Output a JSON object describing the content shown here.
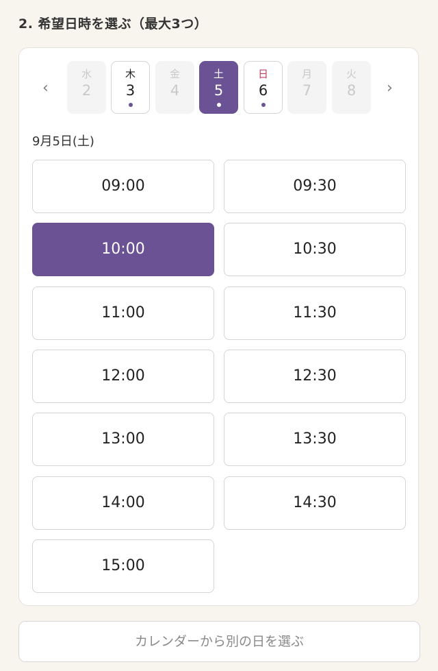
{
  "section": {
    "title": "2. 希望日時を選ぶ（最大3つ）"
  },
  "nav": {
    "prev": "‹",
    "next": "›"
  },
  "days": [
    {
      "weekday": "水",
      "date": "2",
      "state": "disabled"
    },
    {
      "weekday": "木",
      "date": "3",
      "state": "available"
    },
    {
      "weekday": "金",
      "date": "4",
      "state": "disabled"
    },
    {
      "weekday": "土",
      "date": "5",
      "state": "selected"
    },
    {
      "weekday": "日",
      "date": "6",
      "state": "available"
    },
    {
      "weekday": "月",
      "date": "7",
      "state": "disabled"
    },
    {
      "weekday": "火",
      "date": "8",
      "state": "disabled"
    }
  ],
  "selected_date_label": "9月5日(土)",
  "slots": [
    {
      "time": "09:00",
      "selected": false
    },
    {
      "time": "09:30",
      "selected": false
    },
    {
      "time": "10:00",
      "selected": true
    },
    {
      "time": "10:30",
      "selected": false
    },
    {
      "time": "11:00",
      "selected": false
    },
    {
      "time": "11:30",
      "selected": false
    },
    {
      "time": "12:00",
      "selected": false
    },
    {
      "time": "12:30",
      "selected": false
    },
    {
      "time": "13:00",
      "selected": false
    },
    {
      "time": "13:30",
      "selected": false
    },
    {
      "time": "14:00",
      "selected": false
    },
    {
      "time": "14:30",
      "selected": false
    },
    {
      "time": "15:00",
      "selected": false
    }
  ],
  "calendar_button": "カレンダーから別の日を選ぶ",
  "colors": {
    "accent": "#6a5294",
    "sunday": "#c33c5e",
    "background": "#f8f5ef"
  }
}
